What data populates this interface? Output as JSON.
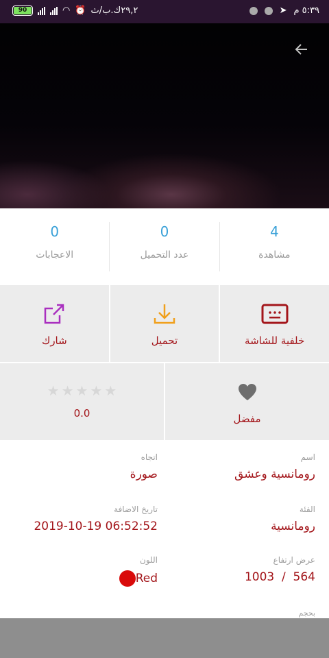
{
  "status_bar": {
    "battery": "90",
    "speed": "٢٩,٢ك.ب/ث",
    "time": "٥:٣٩ م"
  },
  "stats": [
    {
      "value": "4",
      "label": "مشاهدة"
    },
    {
      "value": "0",
      "label": "عدد التحميل"
    },
    {
      "value": "0",
      "label": "الاعجابات"
    }
  ],
  "actions": {
    "wallpaper": "خلفية للشاشة",
    "download": "تحميل",
    "share": "شارك",
    "favorite": "مفضل",
    "rating_value": "0.0",
    "rating_stars": 0,
    "rating_max": 5
  },
  "details": {
    "name": {
      "label": "اسم",
      "value": "رومانسية وعشق"
    },
    "orientation": {
      "label": "اتجاه",
      "value": "صورة"
    },
    "category": {
      "label": "الفئة",
      "value": "رومانسية"
    },
    "date_added": {
      "label": "تاريخ الاضافة",
      "value": "2019-10-19 06:52:52"
    },
    "dimensions": {
      "label": "عرض ارتفاع",
      "value": "1003  /  564"
    },
    "color": {
      "label": "اللون",
      "value": "Red",
      "hex": "#d90a0a"
    },
    "size": {
      "label": "بحجم"
    }
  },
  "colors": {
    "accent_red": "#a3151a",
    "stat_blue": "#3aa1d8",
    "download_orange": "#f0a01c",
    "share_purple": "#a92fbf"
  }
}
